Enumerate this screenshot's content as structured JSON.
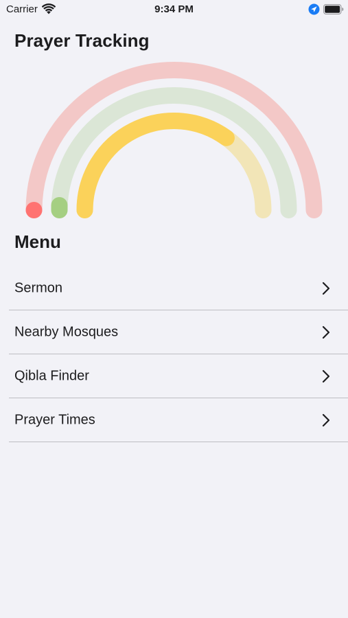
{
  "status_bar": {
    "carrier": "Carrier",
    "time": "9:34 PM",
    "icons": [
      "wifi-icon",
      "location-arrow-icon",
      "battery-icon"
    ],
    "location_color": "#1a7cf5"
  },
  "tracking": {
    "title": "Prayer Tracking",
    "rings": [
      {
        "color": "#f3c8c7",
        "indicator_color": "#ff7371",
        "progress": 0.0
      },
      {
        "color": "#dbe6d6",
        "indicator_color": "#a5cf82",
        "progress": 0.0
      },
      {
        "color": "#f2e5b7",
        "indicator_color": "#fbd25a",
        "progress": 0.7
      }
    ]
  },
  "menu": {
    "title": "Menu",
    "items": [
      {
        "label": "Sermon"
      },
      {
        "label": "Nearby Mosques"
      },
      {
        "label": "Qibla Finder"
      },
      {
        "label": "Prayer Times"
      }
    ]
  }
}
